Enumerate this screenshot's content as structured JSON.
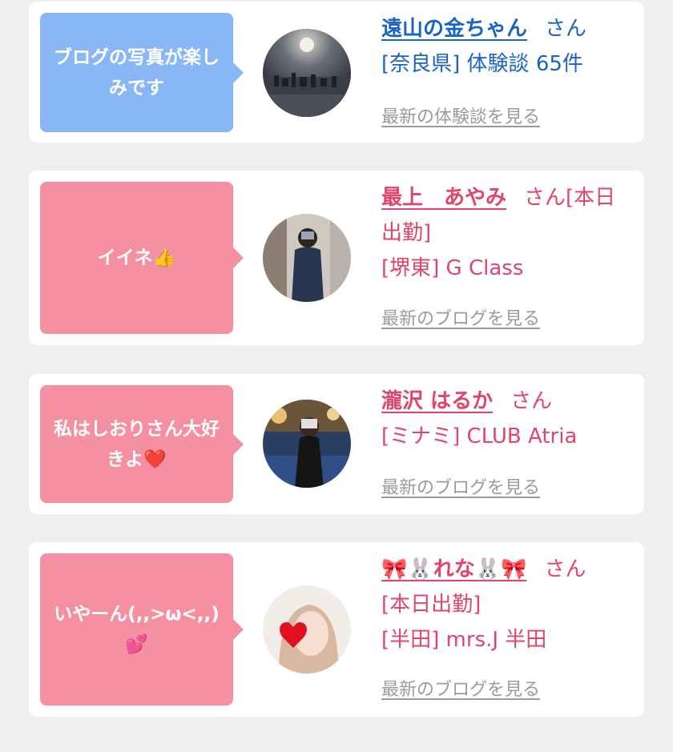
{
  "colors": {
    "blue_bubble": "#89b6f5",
    "pink_bubble": "#f590a3",
    "blue_text": "#1b64c4",
    "pink_text": "#e0456c",
    "link_gray": "#9b9b9b"
  },
  "cards": [
    {
      "theme": "blue",
      "message": "ブログの写真が楽しみです",
      "avatar_icon": "night-city-photo",
      "name": "遠山の金ちゃん",
      "suffix": "さん",
      "detail1": "[奈良県] 体験談 65件",
      "link": "最新の体験談を見る"
    },
    {
      "theme": "pink",
      "message": "イイネ👍",
      "avatar_icon": "woman-photo",
      "name": "最上　あやみ",
      "suffix": "さん[本日出勤]",
      "detail1": "[堺東] G Class",
      "link": "最新のブログを見る"
    },
    {
      "theme": "pink",
      "message": "私はしおりさん大好きよ❤️",
      "avatar_icon": "woman-photo",
      "name": "瀧沢 はるか",
      "suffix": "さん",
      "detail1": "[ミナミ] CLUB Atria",
      "link": "最新のブログを見る"
    },
    {
      "theme": "pink",
      "message": "いやーん(,,>ω<,,)💕",
      "avatar_icon": "woman-photo-heart",
      "name": "🎀🐰れな🐰🎀",
      "suffix": "さん",
      "detail1": "[本日出勤]",
      "detail2": "[半田] mrs.J 半田",
      "link": "最新のブログを見る"
    }
  ]
}
